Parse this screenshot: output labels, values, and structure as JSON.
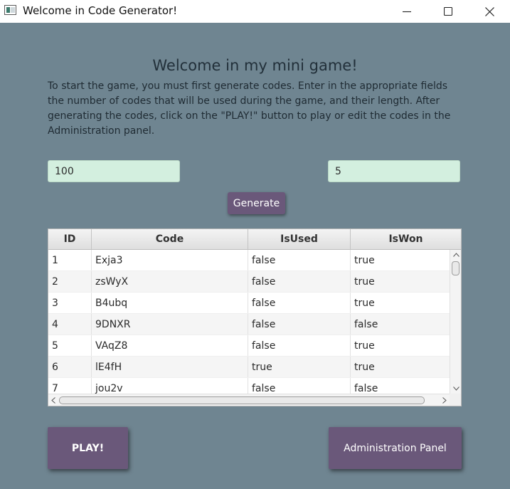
{
  "window": {
    "title": "Welcome in Code Generator!"
  },
  "main": {
    "heading": "Welcome in my mini game!",
    "intro": "To start the game, you must first generate codes. Enter in the appropriate fields the number of codes that will be used during the game, and their length. After generating the codes, click on the \"PLAY!\" button to play or edit the codes in the Administration panel.",
    "code_count_value": "100",
    "code_length_value": "5",
    "generate_label": "Generate"
  },
  "table": {
    "columns": {
      "id": "ID",
      "code": "Code",
      "is_used": "IsUsed",
      "is_won": "IsWon"
    },
    "rows": [
      {
        "id": "1",
        "code": "Exja3",
        "is_used": "false",
        "is_won": "true"
      },
      {
        "id": "2",
        "code": "zsWyX",
        "is_used": "false",
        "is_won": "true"
      },
      {
        "id": "3",
        "code": "B4ubq",
        "is_used": "false",
        "is_won": "true"
      },
      {
        "id": "4",
        "code": "9DNXR",
        "is_used": "false",
        "is_won": "false"
      },
      {
        "id": "5",
        "code": "VAqZ8",
        "is_used": "false",
        "is_won": "true"
      },
      {
        "id": "6",
        "code": "lE4fH",
        "is_used": "true",
        "is_won": "true"
      },
      {
        "id": "7",
        "code": "jou2v",
        "is_used": "false",
        "is_won": "false"
      }
    ]
  },
  "footer": {
    "play_label": "PLAY!",
    "admin_label": "Administration Panel"
  },
  "colors": {
    "background": "#6f8591",
    "button": "#6a587a",
    "input": "#d3efdf"
  }
}
